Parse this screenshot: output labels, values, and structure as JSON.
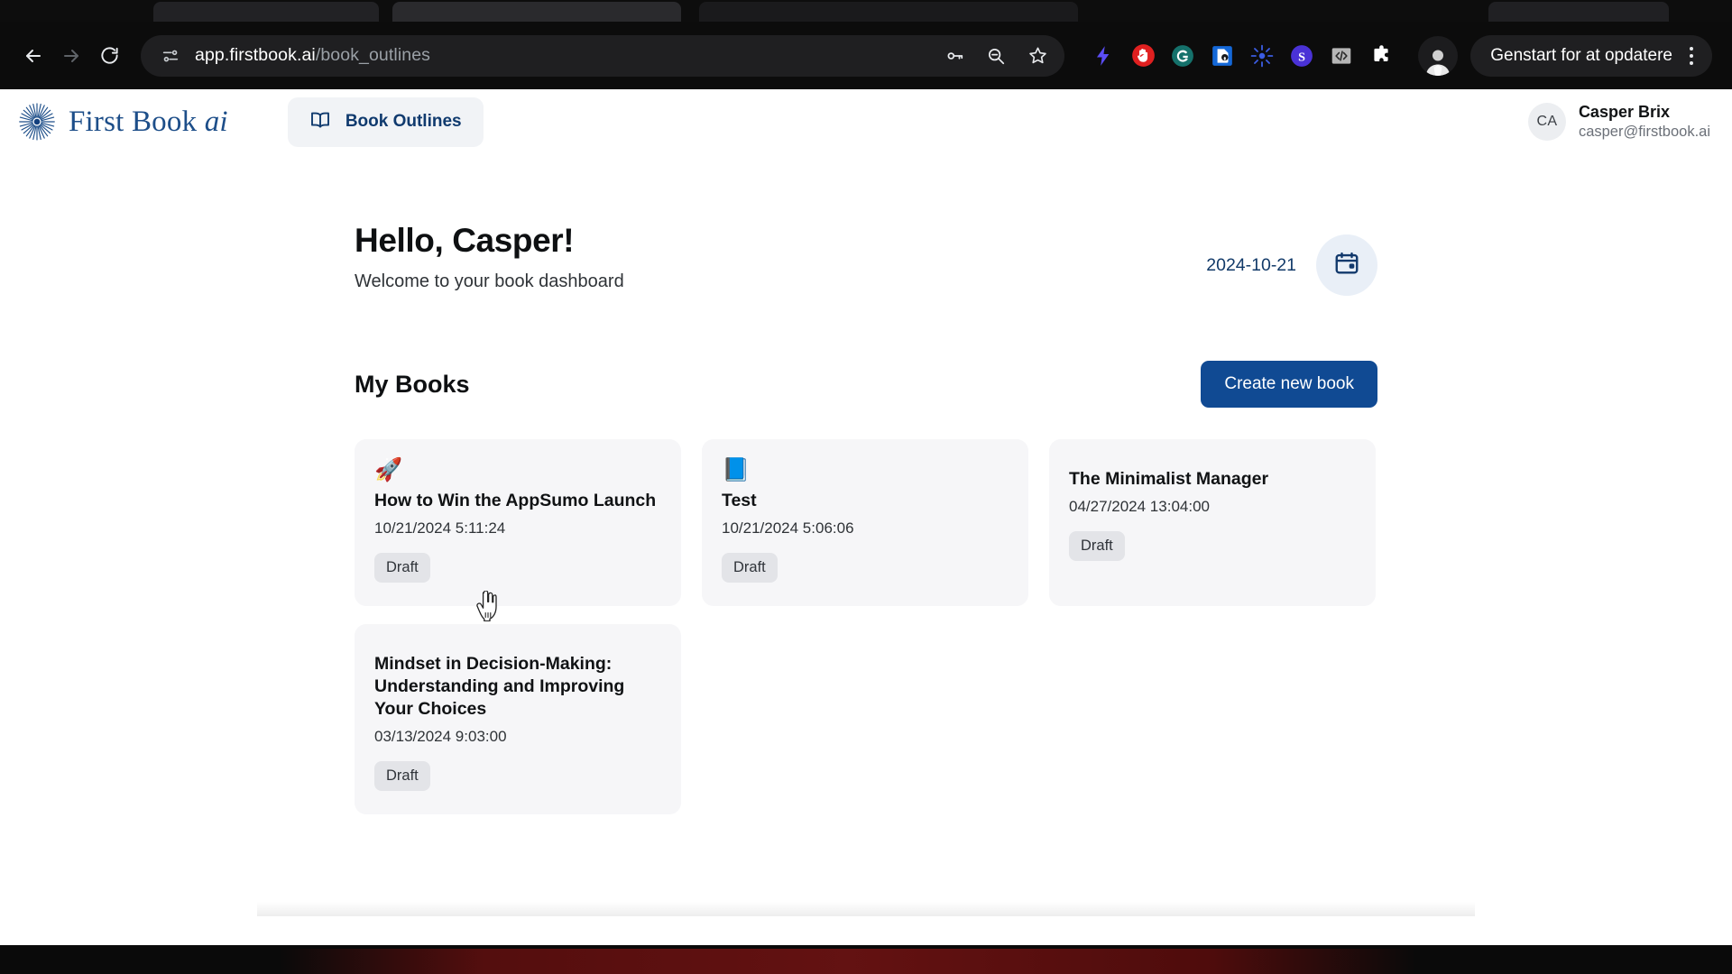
{
  "browser": {
    "back_icon": "arrow-left-icon",
    "forward_icon": "arrow-right-icon",
    "reload_icon": "reload-icon",
    "site_info_icon": "site-settings-icon",
    "url_domain": "app.firstbook.ai",
    "url_path": "/book_outlines",
    "omnibox_actions": [
      {
        "name": "password-key-icon",
        "label": "Passwords"
      },
      {
        "name": "zoom-out-icon",
        "label": "Zoom"
      },
      {
        "name": "bookmark-star-icon",
        "label": "Bookmark this tab"
      }
    ],
    "extensions": [
      {
        "name": "lightning-bolt-icon",
        "color": "#5b4df5"
      },
      {
        "name": "adblock-stop-hand-icon",
        "color": "#e02020"
      },
      {
        "name": "grammarly-g-icon",
        "color": "#15716b"
      },
      {
        "name": "password-manager-shield-icon",
        "color": "#1468d8"
      },
      {
        "name": "sunburst-sparkle-icon",
        "color": "#3b5ce0"
      },
      {
        "name": "s-circle-icon",
        "color": "#4a32d6"
      },
      {
        "name": "code-brackets-icon",
        "color": "#b6b6b6"
      },
      {
        "name": "extensions-puzzle-icon",
        "color": "#ffffff"
      }
    ],
    "profile_icon": "chrome-profile-avatar",
    "update_button_label": "Genstart for at opdatere",
    "menu_icon": "kebab-menu-icon"
  },
  "app": {
    "brand": {
      "logo_icon": "sunburst-logo-icon",
      "name_primary": "First Book ",
      "name_italic": "ai",
      "color": "#1d4e89"
    },
    "nav": {
      "book_outlines": {
        "icon": "open-book-icon",
        "label": "Book Outlines"
      }
    },
    "user": {
      "initials": "CA",
      "name": "Casper Brix",
      "email": "casper@firstbook.ai"
    }
  },
  "dashboard": {
    "greeting_title": "Hello, Casper!",
    "greeting_subtitle": "Welcome to your book dashboard",
    "date_text": "2024-10-21",
    "calendar_icon": "calendar-icon",
    "section_title": "My Books",
    "create_button_label": "Create new book",
    "books": [
      {
        "emoji": "🚀",
        "emoji_name": "rocket-emoji",
        "title": "How to Win the AppSumo Launch",
        "date": "10/21/2024 5:11:24",
        "status": "Draft"
      },
      {
        "emoji": "📘",
        "emoji_name": "blue-book-emoji",
        "title": "Test",
        "date": "10/21/2024 5:06:06",
        "status": "Draft"
      },
      {
        "emoji": "",
        "emoji_name": "none",
        "title": "The Minimalist Manager",
        "date": "04/27/2024 13:04:00",
        "status": "Draft"
      },
      {
        "emoji": "",
        "emoji_name": "none",
        "title": "Mindset in Decision-Making: Understanding and Improving Your Choices",
        "date": "03/13/2024 9:03:00",
        "status": "Draft"
      }
    ]
  },
  "colors": {
    "brand_blue": "#1d4e89",
    "button_blue": "#104a93",
    "card_bg": "#f6f6f8",
    "badge_bg": "#e3e4e8",
    "page_bg": "#ffffff",
    "chrome_bg": "#0c0c0c"
  }
}
